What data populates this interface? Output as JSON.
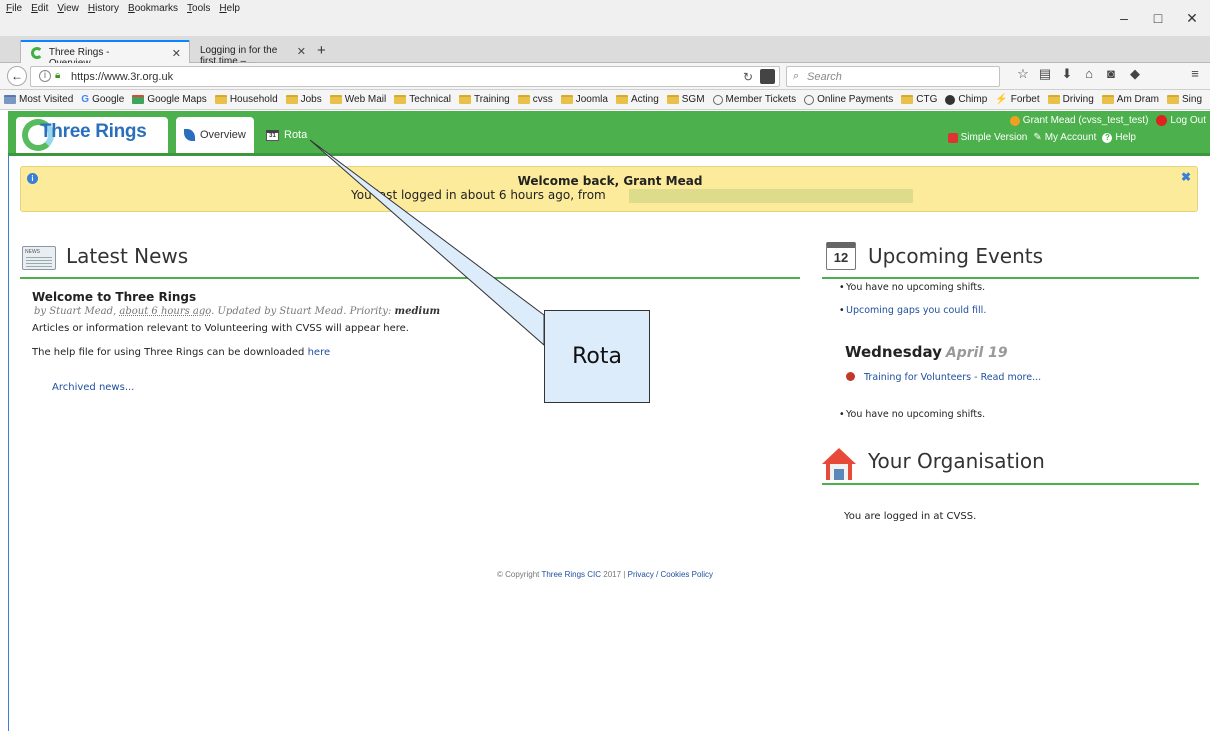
{
  "browser": {
    "menu": [
      "File",
      "Edit",
      "View",
      "History",
      "Bookmarks",
      "Tools",
      "Help"
    ],
    "tabs": [
      {
        "label": "Three Rings - Overview",
        "active": true
      },
      {
        "label": "Logging in for the first time – ...",
        "active": false
      }
    ],
    "url": "https://www.3r.org.uk",
    "search_placeholder": "Search",
    "bookmarks": [
      {
        "label": "Most Visited",
        "icon": "page-icon"
      },
      {
        "label": "Google",
        "icon": "google-icon"
      },
      {
        "label": "Google Maps",
        "icon": "maps-icon"
      },
      {
        "label": "Household",
        "icon": "folder-icon"
      },
      {
        "label": "Jobs",
        "icon": "folder-icon"
      },
      {
        "label": "Web Mail",
        "icon": "folder-icon"
      },
      {
        "label": "Technical",
        "icon": "folder-icon"
      },
      {
        "label": "Training",
        "icon": "folder-icon"
      },
      {
        "label": "cvss",
        "icon": "folder-icon"
      },
      {
        "label": "Joomla",
        "icon": "folder-icon"
      },
      {
        "label": "Acting",
        "icon": "folder-icon"
      },
      {
        "label": "SGM",
        "icon": "folder-icon"
      },
      {
        "label": "Member Tickets",
        "icon": "globe-icon"
      },
      {
        "label": "Online Payments",
        "icon": "globe-icon"
      },
      {
        "label": "CTG",
        "icon": "folder-icon"
      },
      {
        "label": "Chimp",
        "icon": "chimp-icon"
      },
      {
        "label": "Forbet",
        "icon": "forbet-icon"
      },
      {
        "label": "Driving",
        "icon": "folder-icon"
      },
      {
        "label": "Am Dram",
        "icon": "folder-icon"
      },
      {
        "label": "Sing",
        "icon": "folder-icon"
      }
    ]
  },
  "app": {
    "logo": "Three Rings",
    "tabs": {
      "overview": "Overview",
      "rota": "Rota",
      "rota_cal_day": "31"
    },
    "user": "Grant Mead (cvss_test_test)",
    "logout": "Log Out",
    "simple_version": "Simple Version",
    "my_account": "My Account",
    "help": "Help",
    "accent_color": "#4cb04c"
  },
  "banner": {
    "title": "Welcome back, Grant Mead",
    "subtitle": "You last logged in about 6 hours ago, from"
  },
  "news": {
    "heading": "Latest News",
    "item_title": "Welcome to Three Rings",
    "meta_by": "by Stuart Mead,",
    "meta_when": "about 6 hours ago",
    "meta_updated": ". Updated by Stuart Mead. Priority:",
    "meta_priority": "medium",
    "body1": "Articles or information relevant to Volunteering with CVSS will appear here.",
    "body2": "The help file for using Three Rings can be downloaded",
    "body2_link": "here",
    "archived": "Archived news..."
  },
  "events": {
    "heading": "Upcoming Events",
    "calendar_day": "12",
    "no_shifts": "You have no upcoming shifts.",
    "gaps": "Upcoming gaps you could fill.",
    "day_name": "Wednesday",
    "day_date": "April 19",
    "event": "Training for Volunteers - Read more...",
    "no_shifts_2": "You have no upcoming shifts."
  },
  "organisation": {
    "heading": "Your Organisation",
    "text": "You are logged in at CVSS."
  },
  "footer": {
    "copyright": "© Copyright",
    "company": "Three Rings CIC",
    "year": "2017 |",
    "privacy": "Privacy / Cookies Policy"
  },
  "callout": {
    "label": "Rota"
  }
}
